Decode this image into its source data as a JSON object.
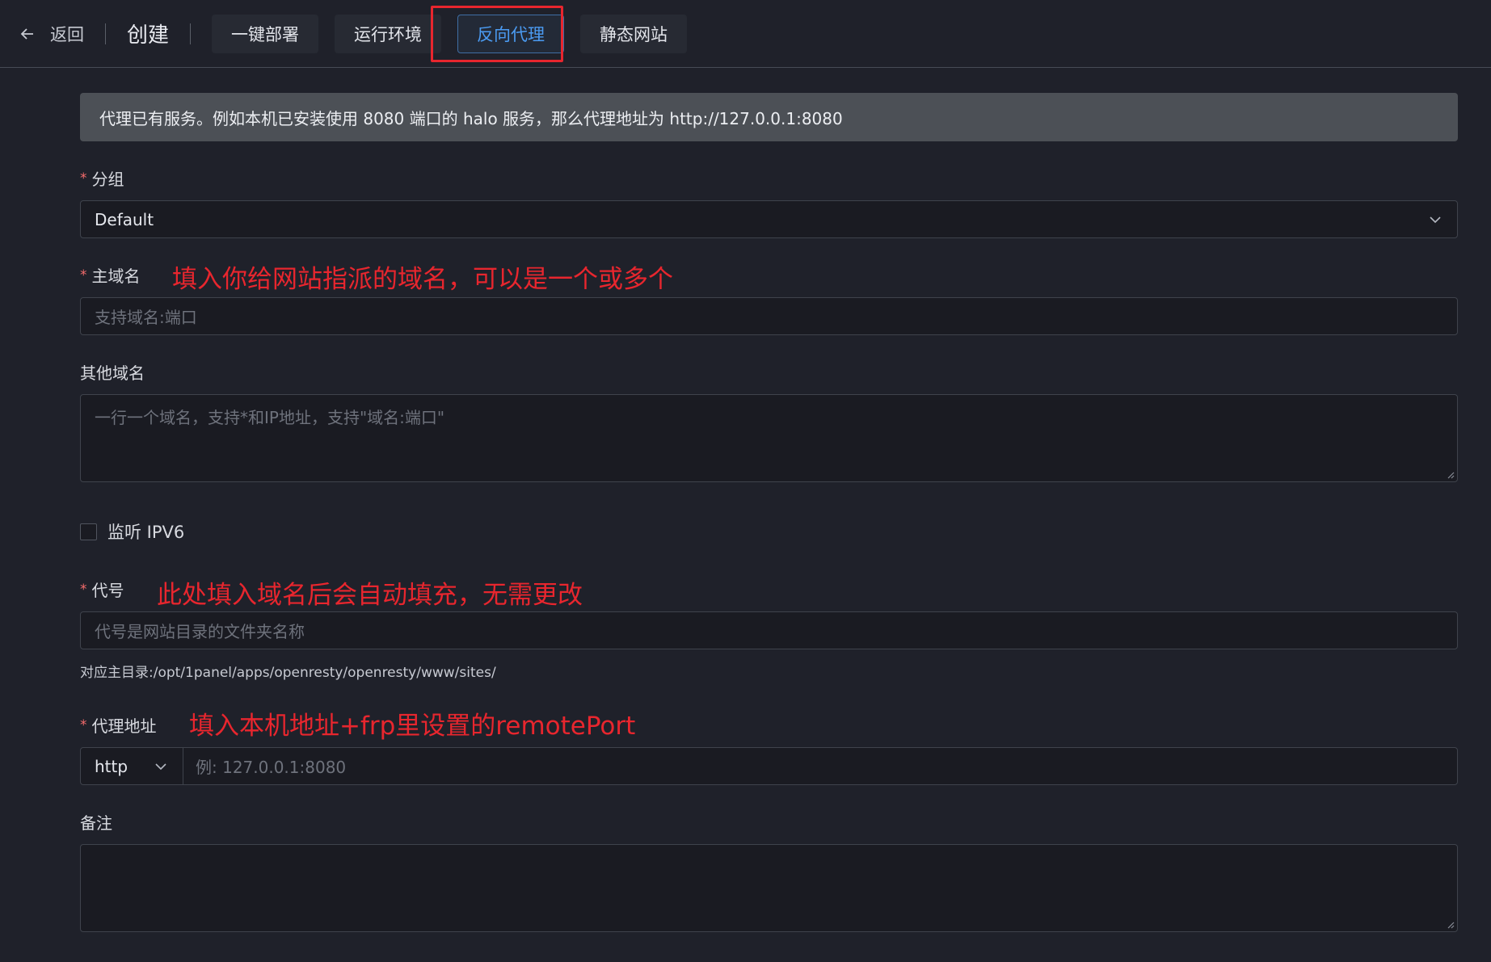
{
  "header": {
    "back_label": "返回",
    "title": "创建",
    "tabs": [
      {
        "label": "一键部署"
      },
      {
        "label": "运行环境"
      },
      {
        "label": "反向代理"
      },
      {
        "label": "静态网站"
      }
    ],
    "active_tab": "反向代理"
  },
  "alert": {
    "text": "代理已有服务。例如本机已安装使用 8080 端口的 halo 服务，那么代理地址为 http://127.0.0.1:8080"
  },
  "form": {
    "group": {
      "required_mark": "*",
      "label": "分组",
      "value": "Default"
    },
    "primary_domain": {
      "required_mark": "*",
      "label": "主域名",
      "placeholder": "支持域名:端口",
      "annotation": "填入你给网站指派的域名，可以是一个或多个"
    },
    "other_domains": {
      "label": "其他域名",
      "placeholder": "一行一个域名，支持*和IP地址，支持\"域名:端口\""
    },
    "ipv6": {
      "label": "监听 IPV6",
      "checked": false
    },
    "alias": {
      "required_mark": "*",
      "label": "代号",
      "placeholder": "代号是网站目录的文件夹名称",
      "annotation": "此处填入域名后会自动填充，无需更改",
      "hint": "对应主目录:/opt/1panel/apps/openresty/openresty/www/sites/"
    },
    "proxy": {
      "required_mark": "*",
      "label": "代理地址",
      "protocol": "http",
      "placeholder": "例: 127.0.0.1:8080",
      "annotation": "填入本机地址+frp里设置的remotePort"
    },
    "remark": {
      "label": "备注"
    }
  },
  "colors": {
    "background": "#1f212a",
    "accent": "#4b9bf2",
    "annotation": "#e8262e",
    "required": "#f56c6c"
  }
}
